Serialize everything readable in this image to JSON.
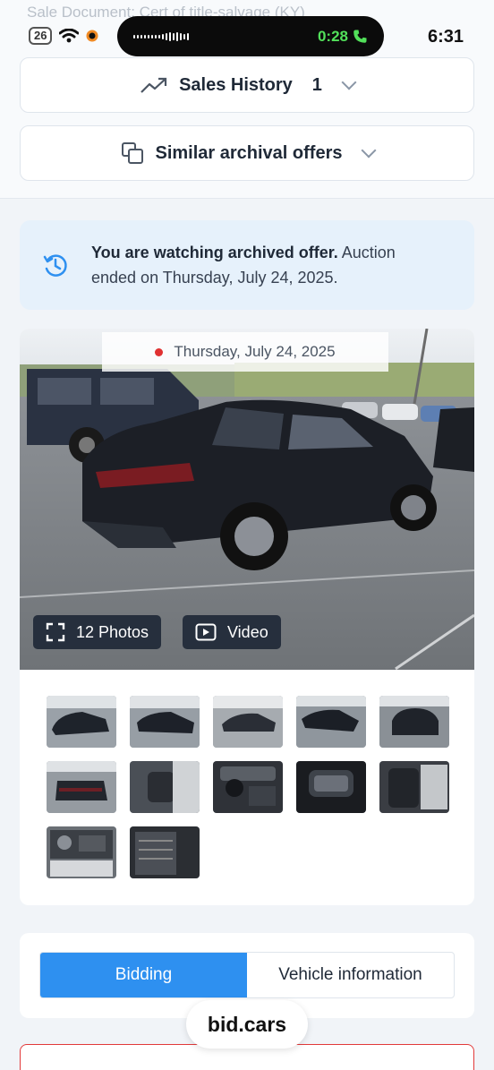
{
  "status_bar": {
    "ghost_text": "Sale Document:  Cert of title-salvage (KY)",
    "notification_count": "26",
    "call_timer": "0:28",
    "clock": "6:31"
  },
  "sales_history": {
    "label": "Sales History",
    "count": "1"
  },
  "similar_offers": {
    "label": "Similar archival offers"
  },
  "archived_notice": {
    "bold": "You are watching archived offer.",
    "rest": " Auction ended on Thursday, July 24, 2025."
  },
  "gallery": {
    "date": "Thursday, July 24, 2025",
    "photos_label": "12 Photos",
    "video_label": "Video"
  },
  "tabs": {
    "bidding": "Bidding",
    "vehicle_info": "Vehicle information",
    "active": "bidding"
  },
  "footer": {
    "domain": "bid.cars"
  },
  "colors": {
    "accent": "#2e90f0",
    "alert": "#e23a3a",
    "banner_bg": "#e6f1fb"
  }
}
